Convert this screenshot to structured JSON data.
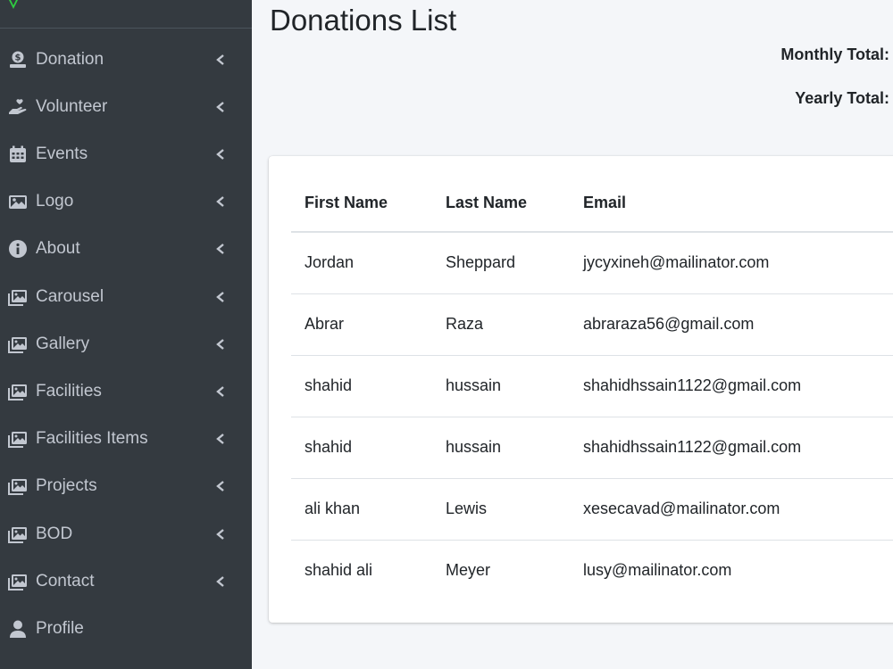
{
  "sidebar": {
    "items": [
      {
        "label": "Donation",
        "icon": "donate-icon",
        "has_caret": true
      },
      {
        "label": "Volunteer",
        "icon": "hand-heart-icon",
        "has_caret": true
      },
      {
        "label": "Events",
        "icon": "calendar-icon",
        "has_caret": true
      },
      {
        "label": "Logo",
        "icon": "image-icon",
        "has_caret": true
      },
      {
        "label": "About",
        "icon": "info-circle-icon",
        "has_caret": true
      },
      {
        "label": "Carousel",
        "icon": "images-icon",
        "has_caret": true
      },
      {
        "label": "Gallery",
        "icon": "images-icon",
        "has_caret": true
      },
      {
        "label": "Facilities",
        "icon": "images-icon",
        "has_caret": true
      },
      {
        "label": "Facilities Items",
        "icon": "images-icon",
        "has_caret": true
      },
      {
        "label": "Projects",
        "icon": "images-icon",
        "has_caret": true
      },
      {
        "label": "BOD",
        "icon": "images-icon",
        "has_caret": true
      },
      {
        "label": "Contact",
        "icon": "images-icon",
        "has_caret": true
      },
      {
        "label": "Profile",
        "icon": "user-icon",
        "has_caret": false
      }
    ]
  },
  "main": {
    "title": "Donations List",
    "monthly_total_label": "Monthly Total:",
    "yearly_total_label": "Yearly Total:",
    "table": {
      "columns": [
        "First Name",
        "Last Name",
        "Email"
      ],
      "rows": [
        [
          "Jordan",
          "Sheppard",
          "jycyxineh@mailinator.com"
        ],
        [
          "Abrar",
          "Raza",
          "abraraza56@gmail.com"
        ],
        [
          "shahid",
          "hussain",
          "shahidhssain1122@gmail.com"
        ],
        [
          "shahid",
          "hussain",
          "shahidhssain1122@gmail.com"
        ],
        [
          "ali khan",
          "Lewis",
          "xesecavad@mailinator.com"
        ],
        [
          "shahid ali",
          "Meyer",
          "lusy@mailinator.com"
        ]
      ]
    }
  },
  "colors": {
    "sidebar_bg": "#343a40",
    "sidebar_text": "#c2c7d0",
    "content_bg": "#f4f6f9",
    "brand_accent": "#28a745"
  }
}
